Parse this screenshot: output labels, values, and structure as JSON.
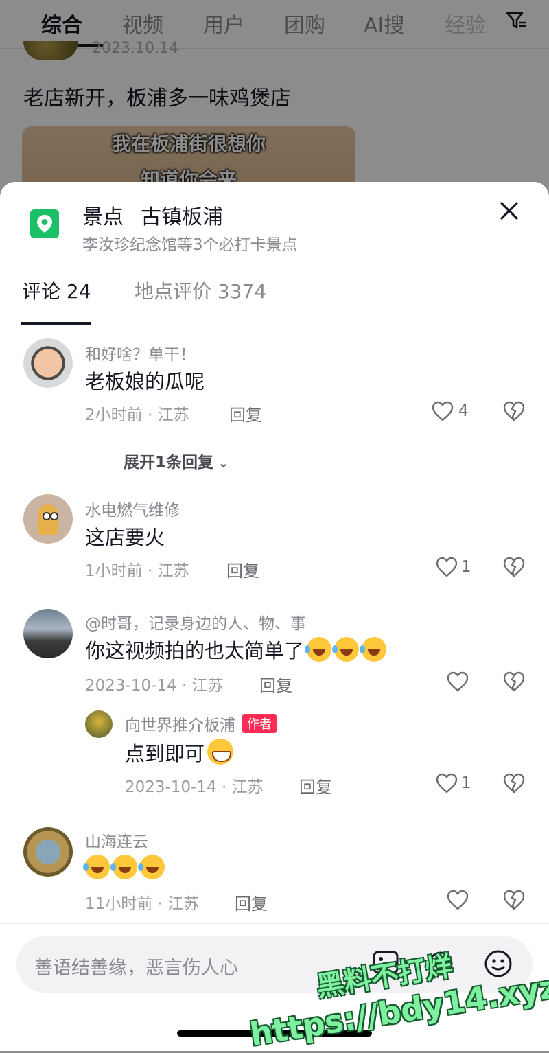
{
  "top_tabs": [
    "综合",
    "视频",
    "用户",
    "团购",
    "AI搜",
    "经验"
  ],
  "background": {
    "date": "2023.10.14",
    "post_title": "老店新开，板浦多一味鸡煲店",
    "thumb_caption_1": "我在板浦街很想你",
    "thumb_caption_2": "知道你会来"
  },
  "location": {
    "category": "景点",
    "name": "古镇板浦",
    "subtitle": "李汝珍纪念馆等3个必打卡景点"
  },
  "tabs": {
    "comments": "评论 24",
    "reviews": "地点评价 3374"
  },
  "comments": [
    {
      "user": "和好啥？单干！",
      "text": "老板娘的瓜呢",
      "meta": "2小时前 · 江苏",
      "reply": "回复",
      "likes": "4"
    },
    {
      "user": "水电燃气维修",
      "text": "这店要火",
      "meta": "1小时前 · 江苏",
      "reply": "回复",
      "likes": "1"
    },
    {
      "user": "@时哥，记录身边的人、物、事",
      "text": "你这视频拍的也太简单了",
      "meta": "2023-10-14 · 江苏",
      "reply": "回复",
      "likes": ""
    },
    {
      "user": "山海连云",
      "text": "",
      "meta": "11小时前 · 江苏",
      "reply": "回复",
      "likes": ""
    }
  ],
  "expand_replies": "展开1条回复",
  "sub_reply": {
    "user": "向世界推介板浦",
    "badge": "作者",
    "text": "点到即可",
    "meta": "2023-10-14 · 江苏",
    "reply": "回复",
    "likes": "1"
  },
  "input_placeholder": "善语结善缘，恶言伤人心",
  "watermark": {
    "line1": "黑料不打烊",
    "line2": "https://bdy14.xyz"
  },
  "colors": {
    "location_icon": "#1dc068",
    "author_badge": "#fe2c55"
  }
}
